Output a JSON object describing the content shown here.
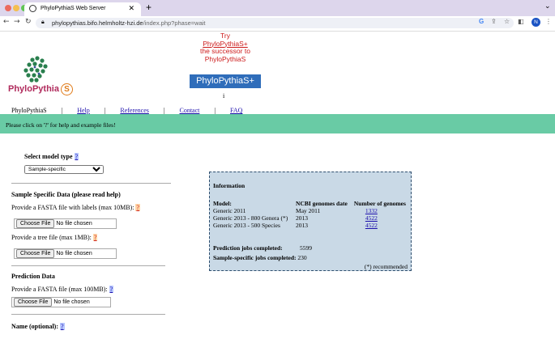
{
  "browser": {
    "tab_title": "PhyloPythiaS Web Server",
    "new_tab": "+",
    "url_host": "phylopythias.bifo.helmholtz-hzi.de",
    "url_path": "/index.php?phase=wait",
    "avatar_initial": "N"
  },
  "promo": {
    "line1": "Try",
    "line2": "PhyloPythiaS+",
    "line3": "the successor to",
    "line4": "PhyloPythiaS",
    "button_label": "PhyloPythiaS+",
    "small_text": "i"
  },
  "logo": {
    "name": "PhyloPythia",
    "suffix": "S"
  },
  "menu": {
    "items": [
      "PhyloPythiaS",
      "Help",
      "References",
      "Contact",
      "FAQ"
    ],
    "separator": "|"
  },
  "banner": {
    "text": "Please click on '?' for help and example files!"
  },
  "form": {
    "model_type_label": "Select model type",
    "model_type_value": "Sample-specific",
    "qmark": "?",
    "sample_heading": "Sample Specific Data (please read help)",
    "fasta_labels_prompt": "Provide a FASTA file with labels (max 10MB):",
    "tree_prompt": "Provide a tree file (max 1MB):",
    "choose_file": "Choose File",
    "no_file": "No file chosen",
    "prediction_heading": "Prediction Data",
    "prediction_prompt": "Provide a FASTA file (max 100MB):",
    "name_label": "Name (optional):"
  },
  "info": {
    "heading": "Information",
    "col_model": "Model:",
    "col_date": "NCBI genomes date",
    "col_count": "Number of genomes",
    "rows": [
      {
        "model": "Generic 2011",
        "date": "May 2011",
        "count": "1332"
      },
      {
        "model": "Generic 2013 - 800 Genera (*)",
        "date": "2013",
        "count": "4522"
      },
      {
        "model": "Generic 2013 - 500 Species",
        "date": "2013",
        "count": "4522"
      }
    ],
    "pred_jobs_label": "Prediction jobs completed:",
    "pred_jobs_value": "5599",
    "sample_jobs_label": "Sample-specific jobs completed:",
    "sample_jobs_value": "230",
    "footnote": "(*) recommended"
  }
}
